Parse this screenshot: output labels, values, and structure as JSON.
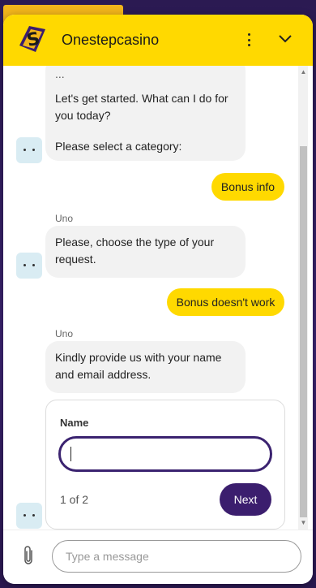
{
  "app": {
    "title": "Onestepcasino"
  },
  "messages": {
    "intro_partial": "...",
    "intro_started": "Let's get started. What can I do for you today?",
    "intro_category": "Please select a category:",
    "user_1": "Bonus info",
    "sender_1": "Uno",
    "bot_2": "Please, choose the type of your request.",
    "user_2": "Bonus doesn't work",
    "sender_2": "Uno",
    "bot_3": "Kindly provide us with your name and email address."
  },
  "form": {
    "label": "Name",
    "value": "",
    "counter": "1 of 2",
    "next_label": "Next"
  },
  "composer": {
    "placeholder": "Type a message"
  },
  "colors": {
    "header": "#ffd900",
    "accent": "#3b1e6e",
    "bubble_in": "#f2f2f2"
  },
  "icons": [
    "logo-icon",
    "kebab-menu-icon",
    "chevron-down-icon",
    "bot-avatar-icon",
    "paperclip-icon"
  ]
}
